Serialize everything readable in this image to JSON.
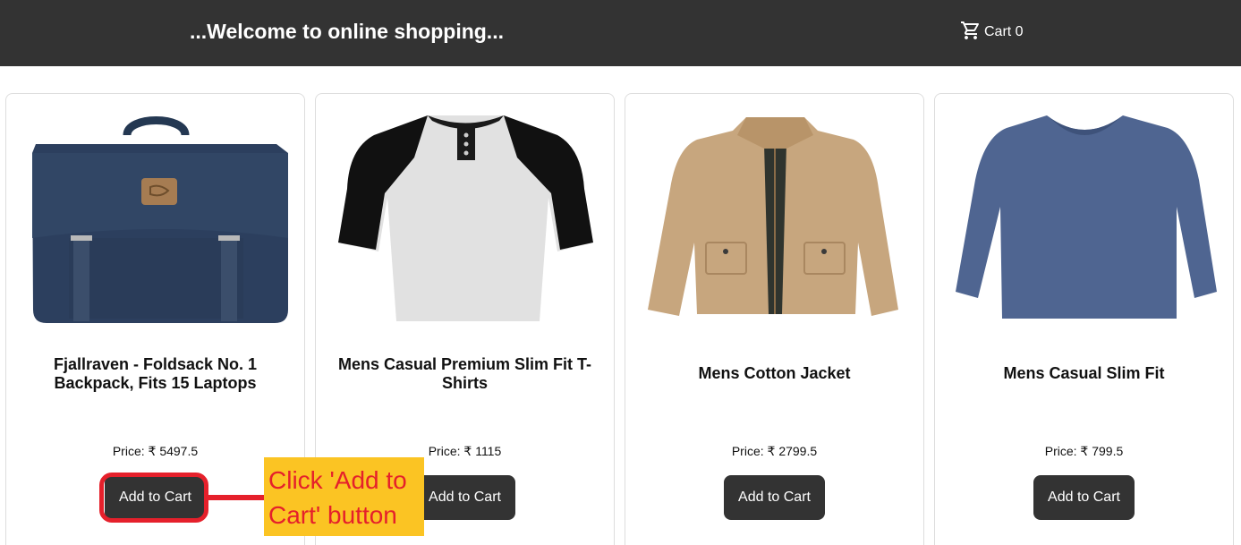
{
  "header": {
    "title": "...Welcome to online shopping...",
    "cart_label": "Cart 0"
  },
  "products": [
    {
      "title": "Fjallraven - Foldsack No. 1 Backpack, Fits 15 Laptops",
      "price": "Price: ₹ 5497.5",
      "button": "Add to Cart",
      "image_icon": "backpack-image"
    },
    {
      "title": "Mens Casual Premium Slim Fit T-Shirts",
      "price": "Price: ₹ 1115",
      "button": "Add to Cart",
      "image_icon": "raglan-tshirt-image"
    },
    {
      "title": "Mens Cotton Jacket",
      "price": "Price: ₹ 2799.5",
      "button": "Add to Cart",
      "image_icon": "jacket-image"
    },
    {
      "title": "Mens Casual Slim Fit",
      "price": "Price: ₹ 799.5",
      "button": "Add to Cart",
      "image_icon": "longsleeve-shirt-image"
    }
  ],
  "annotation": {
    "callout_text": "Click 'Add to Cart' button",
    "colors": {
      "highlight": "#e5202b",
      "callout_bg": "#fbc423"
    }
  },
  "colors": {
    "header_bg": "#333333",
    "button_bg": "#333333"
  }
}
